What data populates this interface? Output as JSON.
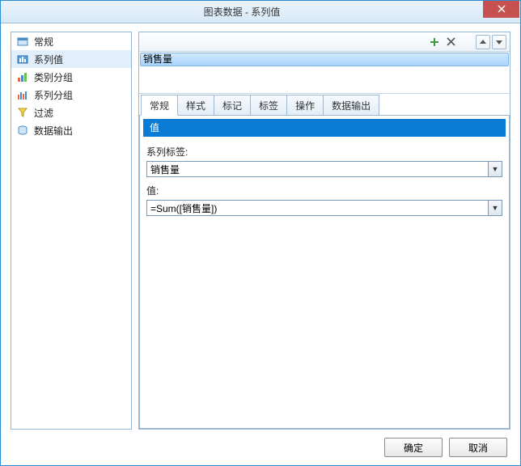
{
  "window": {
    "title": "图表数据 - 系列值"
  },
  "sidebar": {
    "items": [
      {
        "label": "常规"
      },
      {
        "label": "系列值"
      },
      {
        "label": "类别分组"
      },
      {
        "label": "系列分组"
      },
      {
        "label": "过滤"
      },
      {
        "label": "数据输出"
      }
    ],
    "selected_index": 1
  },
  "series_list": {
    "items": [
      {
        "label": "销售量"
      }
    ],
    "selected_index": 0
  },
  "tabs": {
    "items": [
      {
        "label": "常规"
      },
      {
        "label": "样式"
      },
      {
        "label": "标记"
      },
      {
        "label": "标签"
      },
      {
        "label": "操作"
      },
      {
        "label": "数据输出"
      }
    ],
    "active_index": 0
  },
  "panel": {
    "section_title": "值",
    "series_label_caption": "系列标签:",
    "series_label_value": "销售量",
    "value_caption": "值:",
    "value_value": "=Sum([销售量])"
  },
  "buttons": {
    "ok": "确定",
    "cancel": "取消"
  }
}
